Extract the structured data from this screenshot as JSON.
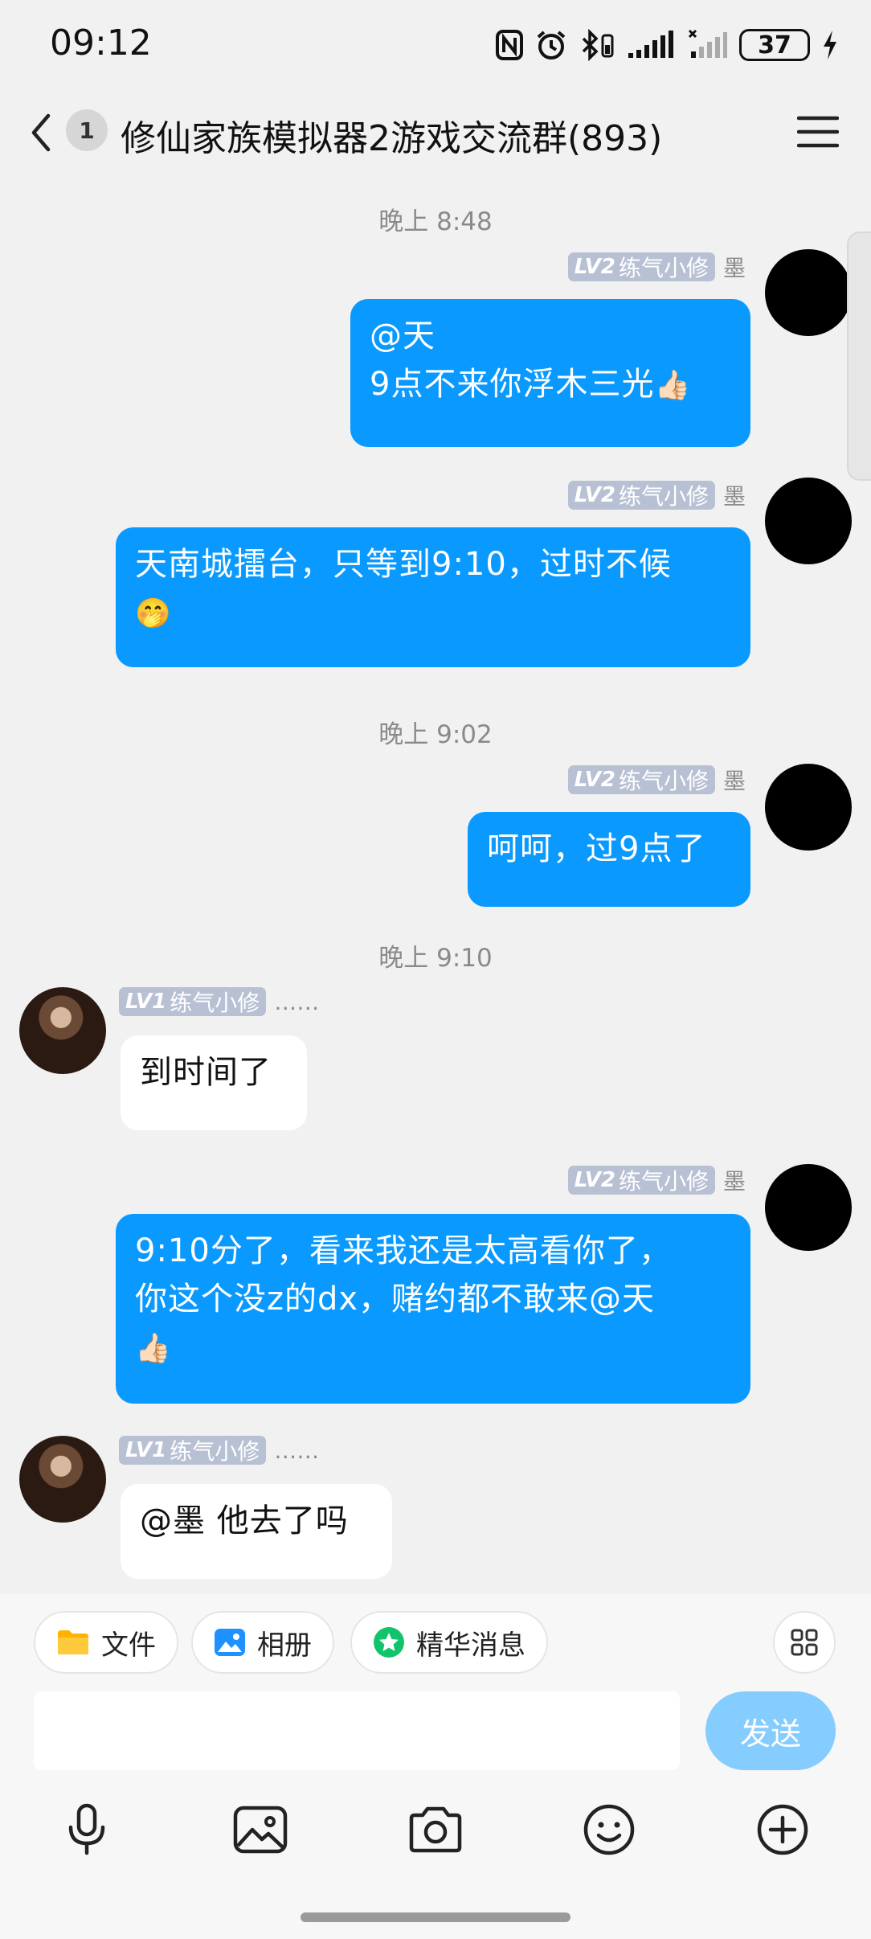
{
  "status_bar": {
    "time": "09:12",
    "battery": "37"
  },
  "header": {
    "unread_count": "1",
    "title": "修仙家族模拟器2游戏交流群(893)"
  },
  "messages": [
    {
      "timestamp": "晚上 8:48"
    },
    {
      "level": "LV2",
      "rank": "练气小修",
      "sender": "墨",
      "lines": [
        "@天",
        "9点不来你浮木三光"
      ],
      "emoji": "👍🏻"
    },
    {
      "level": "LV2",
      "rank": "练气小修",
      "sender": "墨",
      "lines": [
        "天南城擂台，只等到9:10，过时不候"
      ],
      "emoji": "🤭"
    },
    {
      "timestamp": "晚上 9:02"
    },
    {
      "level": "LV2",
      "rank": "练气小修",
      "sender": "墨",
      "lines": [
        "呵呵，过9点了"
      ]
    },
    {
      "timestamp": "晚上 9:10"
    },
    {
      "level": "LV1",
      "rank": "练气小修",
      "sender": "……",
      "lines": [
        "到时间了"
      ]
    },
    {
      "level": "LV2",
      "rank": "练气小修",
      "sender": "墨",
      "lines": [
        "9:10分了，看来我还是太高看你了，",
        "你这个没z的dx，赌约都不敢来@天"
      ],
      "emoji": "👍🏻"
    },
    {
      "level": "LV1",
      "rank": "练气小修",
      "sender": "……",
      "lines": [
        "@墨 他去了吗"
      ]
    }
  ],
  "toolbar": {
    "file_label": "文件",
    "album_label": "相册",
    "featured_label": "精华消息",
    "input_value": "",
    "send_label": "发送"
  },
  "icons": [
    "back-icon",
    "menu-icon",
    "folder-icon",
    "image-icon",
    "star-icon",
    "apps-icon",
    "microphone-icon",
    "picture-icon",
    "camera-icon",
    "emoji-icon",
    "plus-icon"
  ],
  "colors": {
    "my_bubble": "#0a99ff",
    "send_button": "#85ccff",
    "level_badge": "#b8c0d3"
  }
}
